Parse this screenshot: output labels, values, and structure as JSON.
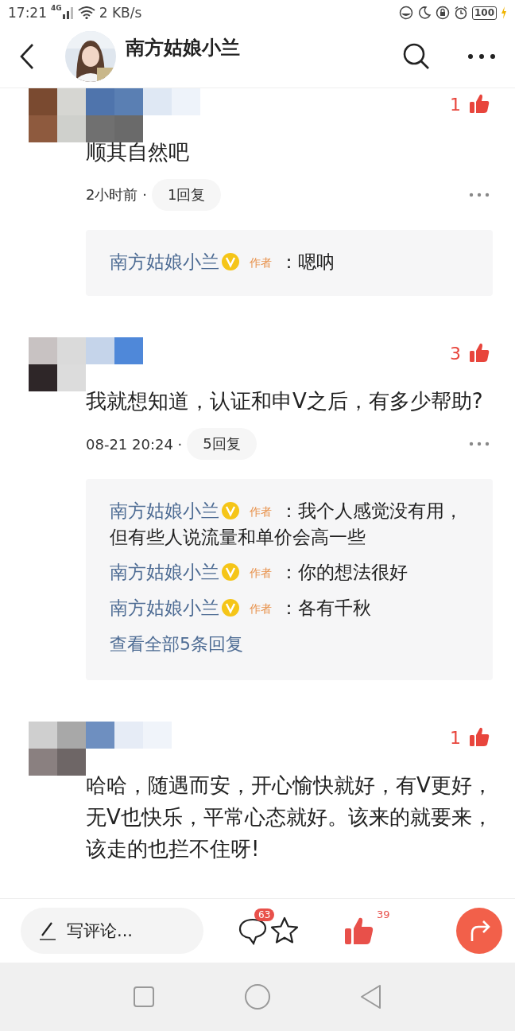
{
  "status_bar": {
    "time": "17:21",
    "network": "4G",
    "speed": "2 KB/s",
    "battery": "100"
  },
  "header": {
    "title": "南方姑娘小兰"
  },
  "comments": [
    {
      "likes": "1",
      "text": "顺其自然吧",
      "time": "2小时前 ·",
      "replies_button": "1回复",
      "replies": [
        {
          "author": "南方姑娘小兰",
          "verified": true,
          "tag": "作者",
          "text": "：嗯呐"
        }
      ]
    },
    {
      "likes": "3",
      "text": "我就想知道，认证和申V之后，有多少帮助?",
      "time": "08-21 20:24 ·",
      "replies_button": "5回复",
      "replies": [
        {
          "author": "南方姑娘小兰",
          "verified": true,
          "tag": "作者",
          "text": "：我个人感觉没有用，但有些人说流量和单价会高一些"
        },
        {
          "author": "南方姑娘小兰",
          "verified": true,
          "tag": "作者",
          "text": "：你的想法很好"
        },
        {
          "author": "南方姑娘小兰",
          "verified": true,
          "tag": "作者",
          "text": "：各有千秋"
        }
      ],
      "view_all": "查看全部5条回复"
    },
    {
      "likes": "1",
      "text": "哈哈，随遇而安，开心愉快就好，有V更好，无V也快乐，平常心态就好。该来的就要来，该走的也拦不住呀!"
    }
  ],
  "bottom_bar": {
    "placeholder": "写评论...",
    "comment_count": "63",
    "like_count": "39"
  }
}
